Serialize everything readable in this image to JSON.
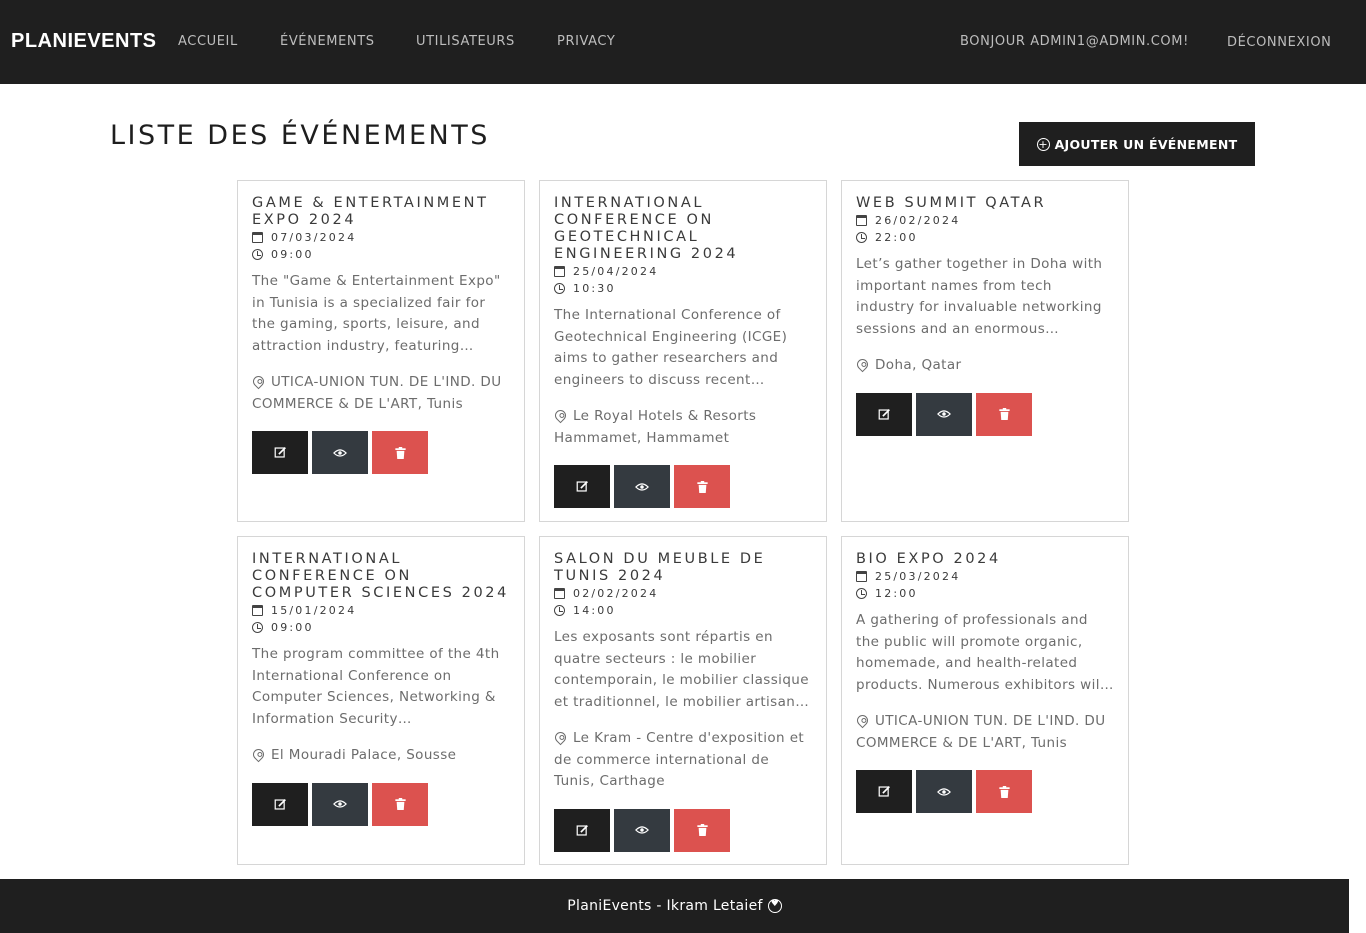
{
  "navbar": {
    "brand": "PLANIEVENTS",
    "links": [
      "ACCUEIL",
      "ÉVÉNEMENTS",
      "UTILISATEURS",
      "PRIVACY"
    ],
    "greeting": "BONJOUR ADMIN1@ADMIN.COM!",
    "logout": "DÉCONNEXION"
  },
  "header": {
    "title": "LISTE DES ÉVÉNEMENTS",
    "add_button": "AJOUTER UN ÉVÉNEMENT"
  },
  "events": [
    {
      "title": "GAME & ENTERTAINMENT EXPO 2024",
      "date": "07/03/2024",
      "time": "09:00",
      "description": "The \"Game & Entertainment Expo\" in Tunisia is a specialized fair for the gaming, sports, leisure, and attraction industry, featuring…",
      "location": "UTICA-UNION TUN. DE L'IND. DU COMMERCE & DE L'ART, Tunis"
    },
    {
      "title": "INTERNATIONAL CONFERENCE ON GEOTECHNICAL ENGINEERING 2024",
      "date": "25/04/2024",
      "time": "10:30",
      "description": "The International Conference of Geotechnical Engineering (ICGE) aims to gather researchers and engineers to discuss recent…",
      "location": "Le Royal Hotels & Resorts Hammamet, Hammamet"
    },
    {
      "title": "WEB SUMMIT QATAR",
      "date": "26/02/2024",
      "time": "22:00",
      "description": "Let’s gather together in Doha with important names from tech industry for invaluable networking sessions and an enormous…",
      "location": "Doha, Qatar"
    },
    {
      "title": "INTERNATIONAL CONFERENCE ON COMPUTER SCIENCES 2024",
      "date": "15/01/2024",
      "time": "09:00",
      "description": "The program committee of the 4th International Conference on Computer Sciences, Networking & Information Security…",
      "location": "El Mouradi Palace, Sousse"
    },
    {
      "title": "SALON DU MEUBLE DE TUNIS 2024",
      "date": "02/02/2024",
      "time": "14:00",
      "description": "Les exposants sont répartis en quatre secteurs : le mobilier contemporain, le mobilier classique et traditionnel, le mobilier artisan…",
      "location": "Le Kram - Centre d'exposition et de commerce international de Tunis, Carthage"
    },
    {
      "title": "BIO EXPO 2024",
      "date": "25/03/2024",
      "time": "12:00",
      "description": "A gathering of professionals and the public will promote organic, homemade, and health-related products. Numerous exhibitors wil…",
      "location": "UTICA-UNION TUN. DE L'IND. DU COMMERCE & DE L'ART, Tunis"
    }
  ],
  "footer": {
    "text": "PlaniEvents - Ikram Letaief"
  },
  "colors": {
    "dark": "#1f1f1f",
    "view": "#343a40",
    "delete": "#dc524f"
  },
  "icons": {
    "edit": "edit-icon",
    "view": "eye-icon",
    "delete": "trash-icon",
    "date": "calendar-icon",
    "time": "clock-icon",
    "location": "map-pin-icon",
    "add": "plus-circle-icon",
    "footer": "heart-icon"
  }
}
